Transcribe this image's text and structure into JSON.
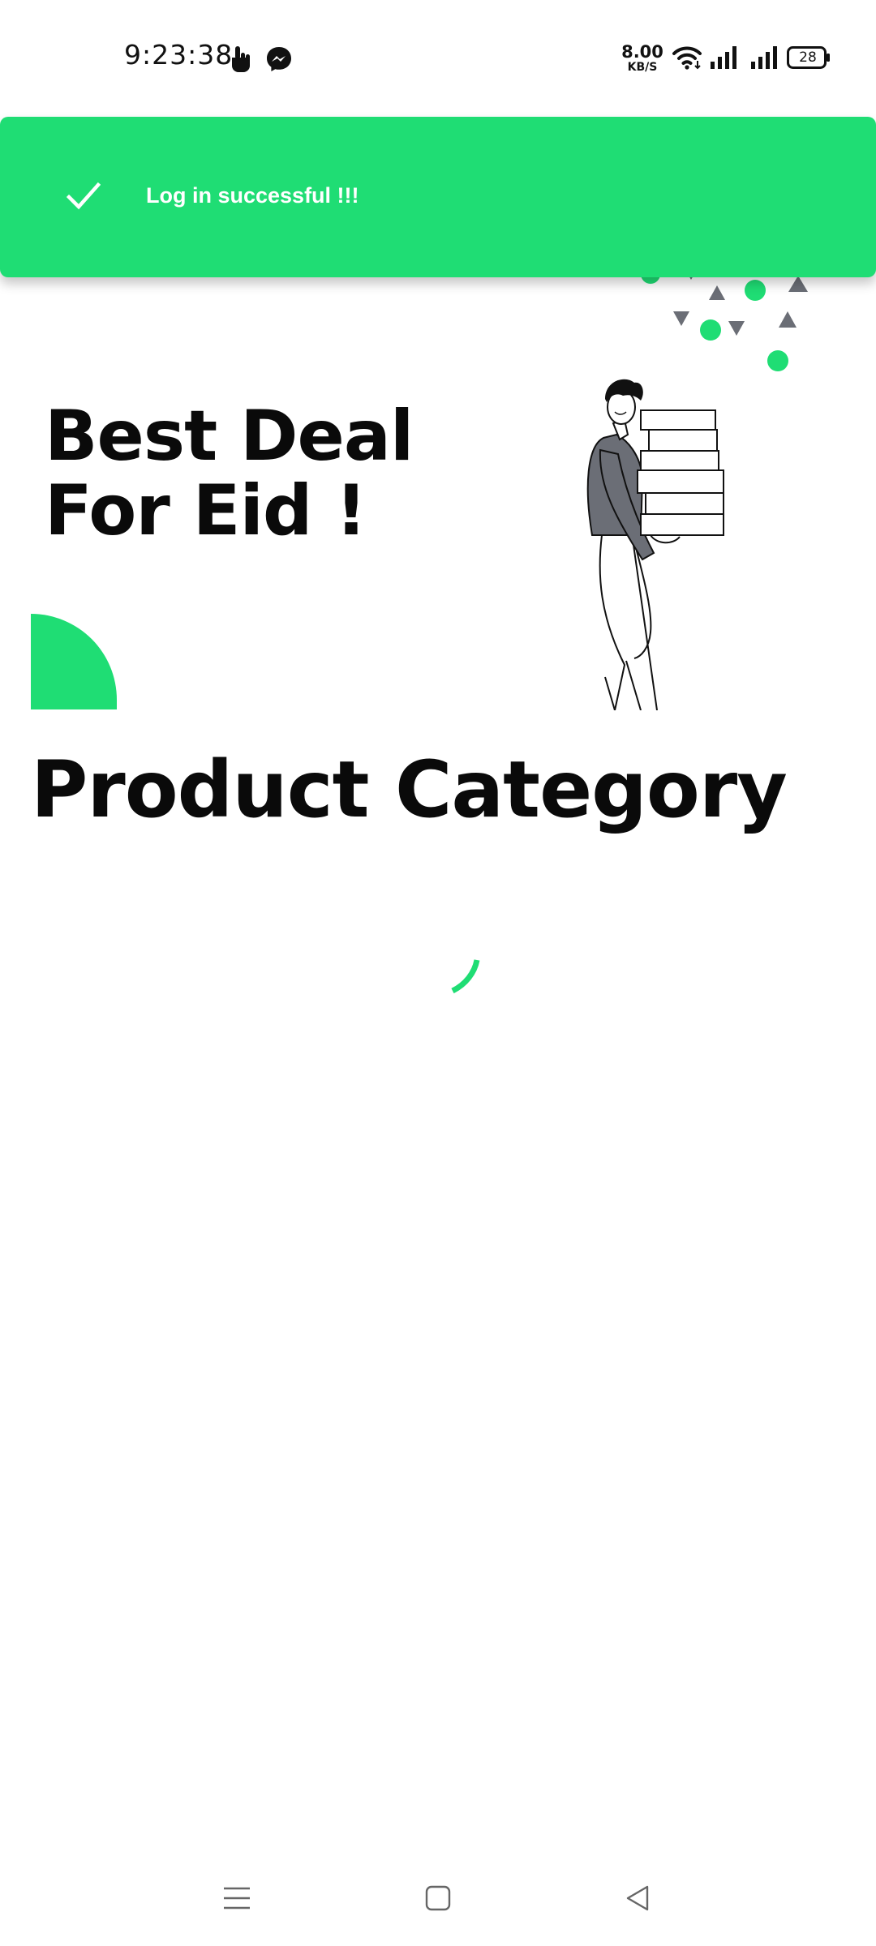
{
  "status_bar": {
    "time": "9:23:38",
    "net_speed_value": "8.00",
    "net_speed_unit": "KB/S",
    "battery_level": "28",
    "icons": [
      "touch-icon",
      "messenger-icon",
      "wifi-icon",
      "signal-icon",
      "signal-icon",
      "battery-icon"
    ]
  },
  "toast": {
    "message": "Log in successful !!!",
    "icon": "check-icon",
    "background_color": "#1fdd74"
  },
  "hero": {
    "title_line1": "Best Deal",
    "title_line2": "For Eid !",
    "illustration": "person-carrying-boxes",
    "accent_color": "#1fdd74",
    "secondary_color": "#6b6e76"
  },
  "category": {
    "heading": "Product Category",
    "loading": true,
    "spinner_color": "#1fdd74"
  },
  "nav_bar": {
    "icons": [
      "menu-icon",
      "home-icon",
      "back-icon"
    ]
  }
}
